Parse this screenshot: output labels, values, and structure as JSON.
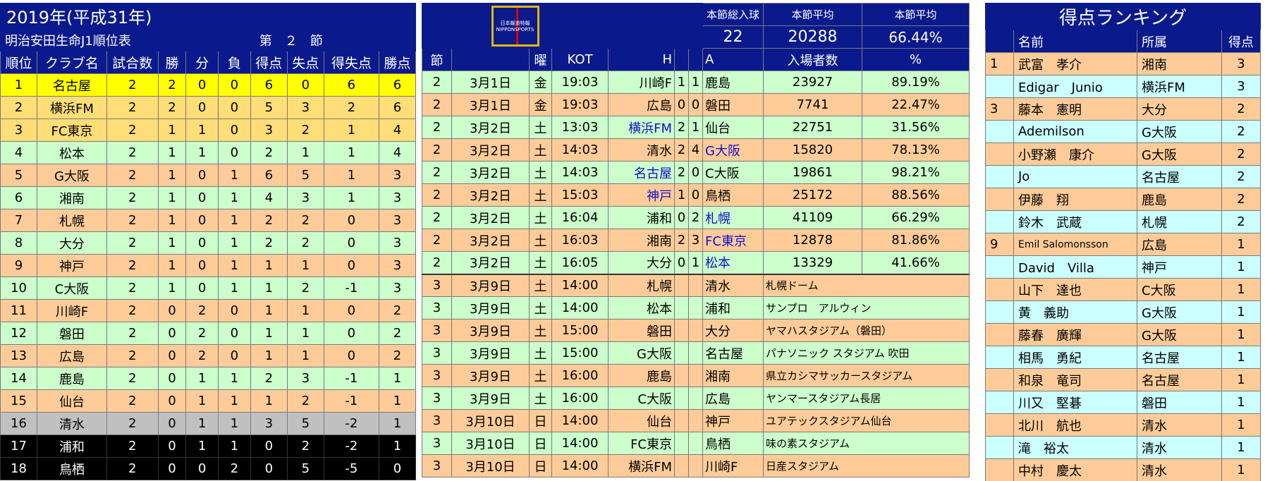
{
  "standings": {
    "title": "2019年(平成31年)",
    "subtitle": "明治安田生命J1順位表",
    "round_label": "第　２　節",
    "headers": [
      "順位",
      "クラブ名",
      "試合数",
      "勝",
      "分",
      "負",
      "得点",
      "失点",
      "得失点",
      "勝点"
    ],
    "rows": [
      {
        "style": "yellow",
        "cells": [
          "1",
          "名古屋",
          "2",
          "2",
          "0",
          "0",
          "6",
          "0",
          "6",
          "6"
        ]
      },
      {
        "style": "gold",
        "cells": [
          "2",
          "横浜FM",
          "2",
          "2",
          "0",
          "0",
          "5",
          "3",
          "2",
          "6"
        ]
      },
      {
        "style": "gold",
        "cells": [
          "3",
          "FC東京",
          "2",
          "1",
          "1",
          "0",
          "3",
          "2",
          "1",
          "4"
        ]
      },
      {
        "style": "green",
        "cells": [
          "4",
          "松本",
          "2",
          "1",
          "1",
          "0",
          "2",
          "1",
          "1",
          "4"
        ]
      },
      {
        "style": "orange",
        "cells": [
          "5",
          "G大阪",
          "2",
          "1",
          "0",
          "1",
          "6",
          "5",
          "1",
          "3"
        ]
      },
      {
        "style": "green",
        "cells": [
          "6",
          "湘南",
          "2",
          "1",
          "0",
          "1",
          "4",
          "3",
          "1",
          "3"
        ]
      },
      {
        "style": "orange",
        "cells": [
          "7",
          "札幌",
          "2",
          "1",
          "0",
          "1",
          "2",
          "2",
          "0",
          "3"
        ]
      },
      {
        "style": "green",
        "cells": [
          "8",
          "大分",
          "2",
          "1",
          "0",
          "1",
          "2",
          "2",
          "0",
          "3"
        ]
      },
      {
        "style": "orange",
        "cells": [
          "9",
          "神戸",
          "2",
          "1",
          "0",
          "1",
          "1",
          "1",
          "0",
          "3"
        ]
      },
      {
        "style": "green",
        "cells": [
          "10",
          "C大阪",
          "2",
          "1",
          "0",
          "1",
          "1",
          "2",
          "-1",
          "3"
        ]
      },
      {
        "style": "orange",
        "cells": [
          "11",
          "川崎F",
          "2",
          "0",
          "2",
          "0",
          "1",
          "1",
          "0",
          "2"
        ]
      },
      {
        "style": "green",
        "cells": [
          "12",
          "磐田",
          "2",
          "0",
          "2",
          "0",
          "1",
          "1",
          "0",
          "2"
        ]
      },
      {
        "style": "orange",
        "cells": [
          "13",
          "広島",
          "2",
          "0",
          "2",
          "0",
          "1",
          "1",
          "0",
          "2"
        ]
      },
      {
        "style": "green",
        "cells": [
          "14",
          "鹿島",
          "2",
          "0",
          "1",
          "1",
          "2",
          "3",
          "-1",
          "1"
        ]
      },
      {
        "style": "orange",
        "cells": [
          "15",
          "仙台",
          "2",
          "0",
          "1",
          "1",
          "1",
          "2",
          "-1",
          "1"
        ]
      },
      {
        "style": "gray",
        "cells": [
          "16",
          "清水",
          "2",
          "0",
          "1",
          "1",
          "3",
          "5",
          "-2",
          "1"
        ]
      },
      {
        "style": "black",
        "cells": [
          "17",
          "浦和",
          "2",
          "0",
          "1",
          "1",
          "0",
          "2",
          "-2",
          "1"
        ]
      },
      {
        "style": "black",
        "cells": [
          "18",
          "鳥栖",
          "2",
          "0",
          "0",
          "2",
          "0",
          "5",
          "-5",
          "0"
        ]
      }
    ]
  },
  "matches": {
    "logo_text_top": "日本報道特報",
    "logo_text_bottom": "NIPPONSPORTS",
    "summary_headers": [
      "本節総入球",
      "本節平均",
      "本節平均"
    ],
    "summary_values": [
      "22",
      "20288",
      "66.44%"
    ],
    "headers": [
      "節",
      "",
      "曜",
      "KOT",
      "H",
      "",
      "",
      "A",
      "入場者数",
      "%"
    ],
    "played": [
      {
        "style": "green",
        "sec": "2",
        "date": "3月1日",
        "day": "金",
        "kot": "19:03",
        "home": "川崎F",
        "hblue": false,
        "hs": "1",
        "as": "1",
        "away": "鹿島",
        "ablue": false,
        "att": "23927",
        "pct": "89.19%"
      },
      {
        "style": "orange",
        "sec": "2",
        "date": "3月1日",
        "day": "金",
        "kot": "19:03",
        "home": "広島",
        "hblue": false,
        "hs": "0",
        "as": "0",
        "away": "磐田",
        "ablue": false,
        "att": "7741",
        "pct": "22.47%"
      },
      {
        "style": "green",
        "sec": "2",
        "date": "3月2日",
        "day": "土",
        "kot": "13:03",
        "home": "横浜FM",
        "hblue": true,
        "hs": "2",
        "as": "1",
        "away": "仙台",
        "ablue": false,
        "att": "22751",
        "pct": "31.56%"
      },
      {
        "style": "orange",
        "sec": "2",
        "date": "3月2日",
        "day": "土",
        "kot": "14:03",
        "home": "清水",
        "hblue": false,
        "hs": "2",
        "as": "4",
        "away": "G大阪",
        "ablue": true,
        "att": "15820",
        "pct": "78.13%"
      },
      {
        "style": "green",
        "sec": "2",
        "date": "3月2日",
        "day": "土",
        "kot": "14:03",
        "home": "名古屋",
        "hblue": true,
        "hs": "2",
        "as": "0",
        "away": "C大阪",
        "ablue": false,
        "att": "19861",
        "pct": "98.21%"
      },
      {
        "style": "orange",
        "sec": "2",
        "date": "3月2日",
        "day": "土",
        "kot": "15:03",
        "home": "神戸",
        "hblue": true,
        "hs": "1",
        "as": "0",
        "away": "鳥栖",
        "ablue": false,
        "att": "25172",
        "pct": "88.56%"
      },
      {
        "style": "green",
        "sec": "2",
        "date": "3月2日",
        "day": "土",
        "kot": "16:04",
        "home": "浦和",
        "hblue": false,
        "hs": "0",
        "as": "2",
        "away": "札幌",
        "ablue": true,
        "att": "41109",
        "pct": "66.29%"
      },
      {
        "style": "orange",
        "sec": "2",
        "date": "3月2日",
        "day": "土",
        "kot": "16:03",
        "home": "湘南",
        "hblue": false,
        "hs": "2",
        "as": "3",
        "away": "FC東京",
        "ablue": true,
        "att": "12878",
        "pct": "81.86%"
      },
      {
        "style": "green",
        "sec": "2",
        "date": "3月2日",
        "day": "土",
        "kot": "16:05",
        "home": "大分",
        "hblue": false,
        "hs": "0",
        "as": "1",
        "away": "松本",
        "ablue": true,
        "att": "13329",
        "pct": "41.66%"
      }
    ],
    "upcoming": [
      {
        "style": "orange",
        "sec": "3",
        "date": "3月9日",
        "day": "土",
        "kot": "14:00",
        "home": "札幌",
        "away": "清水",
        "venue": "札幌ドーム"
      },
      {
        "style": "green",
        "sec": "3",
        "date": "3月9日",
        "day": "土",
        "kot": "14:00",
        "home": "松本",
        "away": "浦和",
        "venue": "サンプロ　アルウィン"
      },
      {
        "style": "orange",
        "sec": "3",
        "date": "3月9日",
        "day": "土",
        "kot": "15:00",
        "home": "磐田",
        "away": "大分",
        "venue": "ヤマハスタジアム（磐田）"
      },
      {
        "style": "green",
        "sec": "3",
        "date": "3月9日",
        "day": "土",
        "kot": "15:00",
        "home": "G大阪",
        "away": "名古屋",
        "venue": "パナソニック スタジアム 吹田"
      },
      {
        "style": "orange",
        "sec": "3",
        "date": "3月9日",
        "day": "土",
        "kot": "16:00",
        "home": "鹿島",
        "away": "湘南",
        "venue": "県立カシマサッカースタジアム"
      },
      {
        "style": "green",
        "sec": "3",
        "date": "3月9日",
        "day": "土",
        "kot": "16:00",
        "home": "C大阪",
        "away": "広島",
        "venue": "ヤンマースタジアム長居"
      },
      {
        "style": "orange",
        "sec": "3",
        "date": "3月10日",
        "day": "日",
        "kot": "14:00",
        "home": "仙台",
        "away": "神戸",
        "venue": "ユアテックスタジアム仙台"
      },
      {
        "style": "green",
        "sec": "3",
        "date": "3月10日",
        "day": "日",
        "kot": "14:00",
        "home": "FC東京",
        "away": "鳥栖",
        "venue": "味の素スタジアム"
      },
      {
        "style": "orange",
        "sec": "3",
        "date": "3月10日",
        "day": "日",
        "kot": "14:00",
        "home": "横浜FM",
        "away": "川崎F",
        "venue": "日産スタジアム"
      }
    ]
  },
  "ranking": {
    "title": "得点ランキング",
    "headers": [
      "",
      "名前",
      "所属",
      "得点"
    ],
    "rows": [
      {
        "style": "pk",
        "cells": [
          "1",
          "武富　孝介",
          "湘南",
          "3"
        ]
      },
      {
        "style": "lb",
        "cells": [
          "",
          "Edigar　Junio",
          "横浜FM",
          "3"
        ]
      },
      {
        "style": "pk",
        "cells": [
          "3",
          "藤本　憲明",
          "大分",
          "2"
        ]
      },
      {
        "style": "lb",
        "cells": [
          "",
          "Ademilson",
          "G大阪",
          "2"
        ]
      },
      {
        "style": "pk",
        "cells": [
          "",
          "小野瀬　康介",
          "G大阪",
          "2"
        ]
      },
      {
        "style": "lb",
        "cells": [
          "",
          "Jo",
          "名古屋",
          "2"
        ]
      },
      {
        "style": "pk",
        "cells": [
          "",
          "伊藤　翔",
          "鹿島",
          "2"
        ]
      },
      {
        "style": "lb",
        "cells": [
          "",
          "鈴木　武蔵",
          "札幌",
          "2"
        ]
      },
      {
        "style": "pk",
        "cells": [
          "9",
          "Emil Salomonsson",
          "広島",
          "1"
        ]
      },
      {
        "style": "lb",
        "cells": [
          "",
          "David　Villa",
          "神戸",
          "1"
        ]
      },
      {
        "style": "pk",
        "cells": [
          "",
          "山下　達也",
          "C大阪",
          "1"
        ]
      },
      {
        "style": "lb",
        "cells": [
          "",
          "黄　義助",
          "G大阪",
          "1"
        ]
      },
      {
        "style": "pk",
        "cells": [
          "",
          "藤春　廣輝",
          "G大阪",
          "1"
        ]
      },
      {
        "style": "lb",
        "cells": [
          "",
          "相馬　勇紀",
          "名古屋",
          "1"
        ]
      },
      {
        "style": "pk",
        "cells": [
          "",
          "和泉　竜司",
          "名古屋",
          "1"
        ]
      },
      {
        "style": "lb",
        "cells": [
          "",
          "川又　堅碁",
          "磐田",
          "1"
        ]
      },
      {
        "style": "pk",
        "cells": [
          "",
          "北川　航也",
          "清水",
          "1"
        ]
      },
      {
        "style": "lb",
        "cells": [
          "",
          "滝　裕太",
          "清水",
          "1"
        ]
      },
      {
        "style": "pk",
        "cells": [
          "",
          "中村　慶太",
          "清水",
          "1"
        ]
      }
    ]
  }
}
